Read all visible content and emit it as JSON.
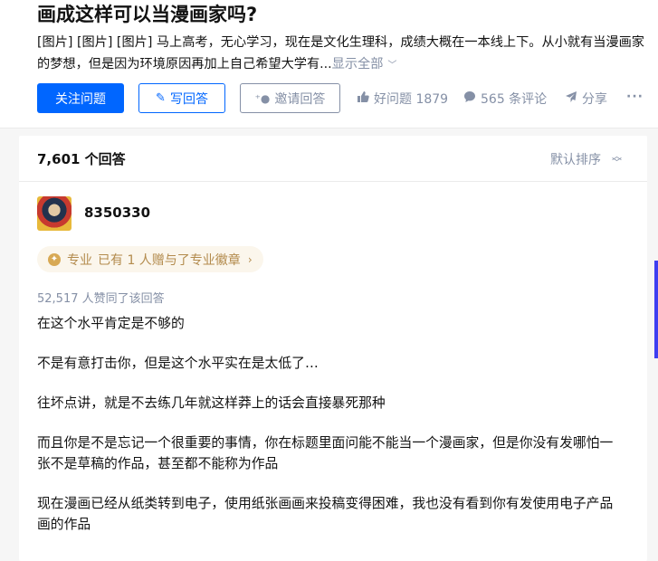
{
  "question": {
    "title": "画成这样可以当漫画家吗?",
    "description": "[图片] [图片] [图片] 马上高考，无心学习，现在是文化生理科，成绩大概在一本线上下。从小就有当漫画家的梦想，但是因为环境原因再加上自己希望大学有...",
    "show_all": "显示全部"
  },
  "actions": {
    "follow": "关注问题",
    "write": "写回答",
    "invite": "邀请回答",
    "good_question": "好问题 1879",
    "comments": "565 条评论",
    "share": "分享",
    "more": "···"
  },
  "answers": {
    "count_label": "7,601 个回答",
    "sort_label": "默认排序"
  },
  "answer": {
    "author": "8350330",
    "badge_tag": "专业",
    "badge_text": "已有 1 人赠与了专业徽章",
    "votes": "52,517 人赞同了该回答",
    "paragraphs": [
      "在这个水平肯定是不够的",
      "不是有意打击你，但是这个水平实在是太低了…",
      "往坏点讲，就是不去练几年就这样莽上的话会直接暴死那种",
      "而且你是不是忘记一个很重要的事情，你在标题里面问能不能当一个漫画家，但是你没有发哪怕一张不是草稿的作品，甚至都不能称为作品",
      "现在漫画已经从纸类转到电子，使用纸张画画来投稿变得困难，我也没有看到你有发使用电子产品画的作品"
    ]
  },
  "icons": {
    "write": "pencil-icon",
    "invite": "add-person-icon",
    "good": "thumbs-up-icon",
    "comment": "comment-bubble-icon",
    "share": "paper-plane-icon",
    "sort": "up-down-chevron-icon",
    "badge": "badge-coin-icon"
  },
  "colors": {
    "primary": "#0066ff",
    "muted": "#8590a6",
    "badge_text": "#b38b4d",
    "badge_bg": "#fbf6ec"
  }
}
